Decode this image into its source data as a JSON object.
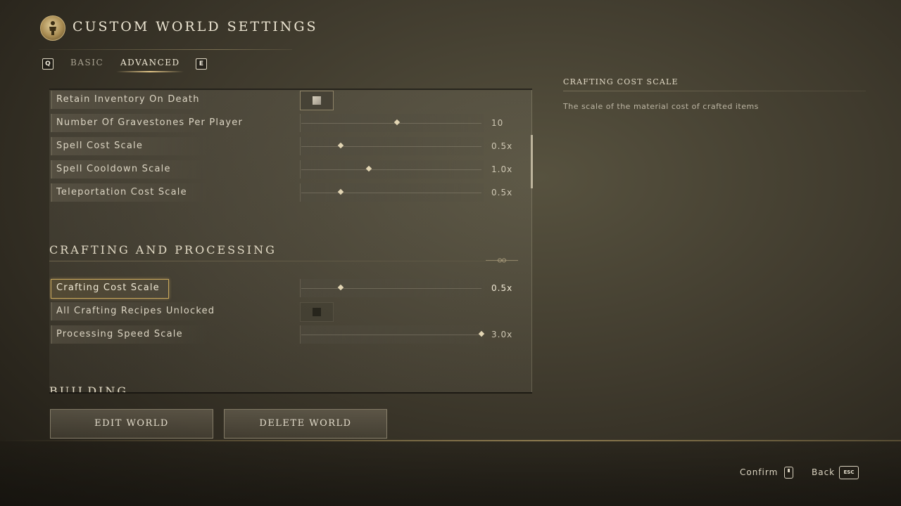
{
  "header": {
    "title": "Custom World Settings"
  },
  "tabs": {
    "prev_key": "Q",
    "next_key": "E",
    "items": [
      {
        "label": "Basic",
        "active": false
      },
      {
        "label": "Advanced",
        "active": true
      }
    ]
  },
  "settings": {
    "rows_top": [
      {
        "label": "Retain Inventory On Death",
        "type": "checkbox",
        "checked": true
      },
      {
        "label": "Number Of Gravestones Per Player",
        "type": "slider",
        "value": "10",
        "fraction": 0.52
      },
      {
        "label": "Spell Cost Scale",
        "type": "slider",
        "value": "0.5x",
        "fraction": 0.21
      },
      {
        "label": "Spell Cooldown Scale",
        "type": "slider",
        "value": "1.0x",
        "fraction": 0.37
      },
      {
        "label": "Teleportation Cost Scale",
        "type": "slider",
        "value": "0.5x",
        "fraction": 0.21
      }
    ],
    "section_crafting": {
      "title": "Crafting and Processing"
    },
    "rows_crafting": [
      {
        "label": "Crafting Cost Scale",
        "type": "slider",
        "value": "0.5x",
        "fraction": 0.21,
        "selected": true
      },
      {
        "label": "All Crafting Recipes Unlocked",
        "type": "checkbox",
        "checked": false
      },
      {
        "label": "Processing Speed Scale",
        "type": "slider",
        "value": "3.0x",
        "fraction": 1.0
      }
    ],
    "section_building": {
      "title": "Building"
    }
  },
  "buttons": {
    "edit_world": "Edit World",
    "delete_world": "Delete World"
  },
  "detail": {
    "title": "Crafting Cost Scale",
    "description": "The scale of the material cost of crafted items"
  },
  "footer": {
    "confirm_label": "Confirm",
    "back_label": "Back",
    "back_key": "ESC"
  },
  "colors": {
    "accent_gold": "#c9a85c",
    "text_primary": "#ece5d2"
  }
}
